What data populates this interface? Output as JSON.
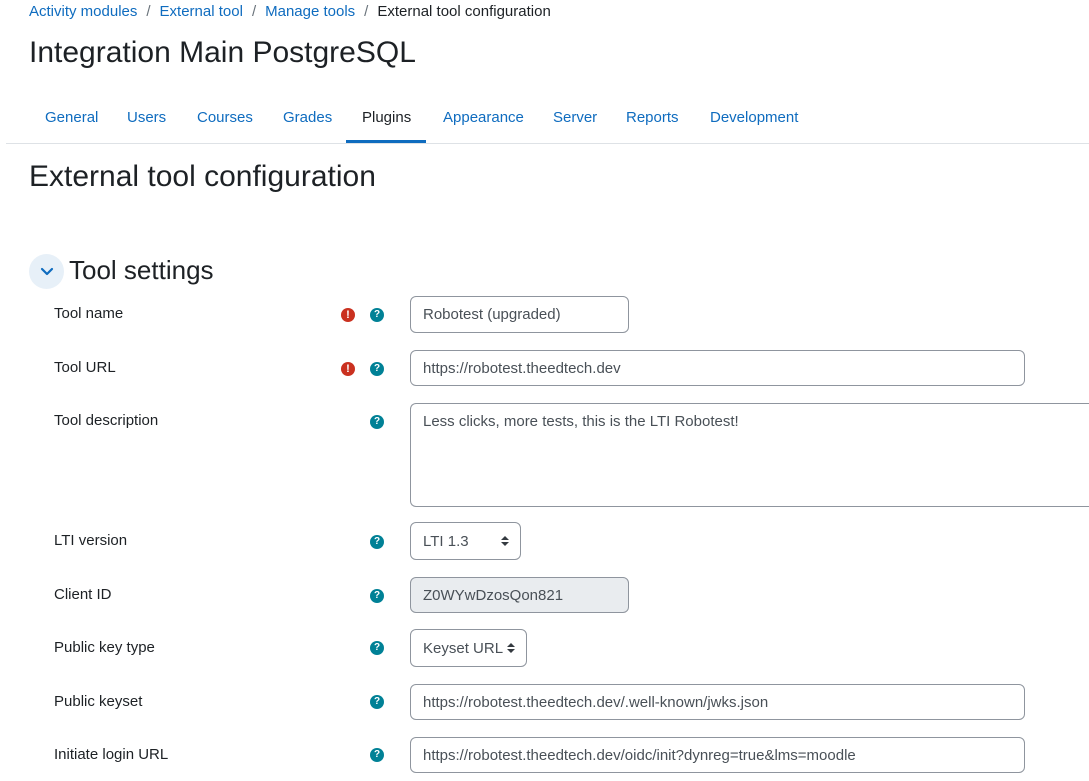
{
  "breadcrumb": {
    "items": [
      "Activity modules",
      "External tool",
      "Manage tools"
    ],
    "separator": "/",
    "current": "External tool configuration"
  },
  "site_title": "Integration Main PostgreSQL",
  "tabs": [
    {
      "label": "General"
    },
    {
      "label": "Users"
    },
    {
      "label": "Courses"
    },
    {
      "label": "Grades"
    },
    {
      "label": "Plugins",
      "active": true
    },
    {
      "label": "Appearance"
    },
    {
      "label": "Server"
    },
    {
      "label": "Reports"
    },
    {
      "label": "Development"
    }
  ],
  "page_heading": "External tool configuration",
  "section": {
    "title": "Tool settings",
    "toggle_icon": "chevron-down-icon"
  },
  "icons": {
    "required": "!",
    "help": "?"
  },
  "form": {
    "tool_name": {
      "label": "Tool name",
      "value": "Robotest (upgraded)",
      "required": true
    },
    "tool_url": {
      "label": "Tool URL",
      "value": "https://robotest.theedtech.dev",
      "required": true
    },
    "tool_description": {
      "label": "Tool description",
      "value": "Less clicks, more tests, this is the LTI Robotest!"
    },
    "lti_version": {
      "label": "LTI version",
      "value": "LTI 1.3"
    },
    "client_id": {
      "label": "Client ID",
      "value": "Z0WYwDzosQon821",
      "disabled": true
    },
    "public_key_type": {
      "label": "Public key type",
      "value": "Keyset URL"
    },
    "public_keyset": {
      "label": "Public keyset",
      "value": "https://robotest.theedtech.dev/.well-known/jwks.json"
    },
    "initiate_login_url": {
      "label": "Initiate login URL",
      "value": "https://robotest.theedtech.dev/oidc/init?dynreg=true&lms=moodle"
    }
  },
  "colors": {
    "link": "#0f6cbf",
    "text": "#1d2125",
    "required_icon": "#ca3120",
    "help_icon": "#008196",
    "disabled_field": "#e9ecef"
  }
}
